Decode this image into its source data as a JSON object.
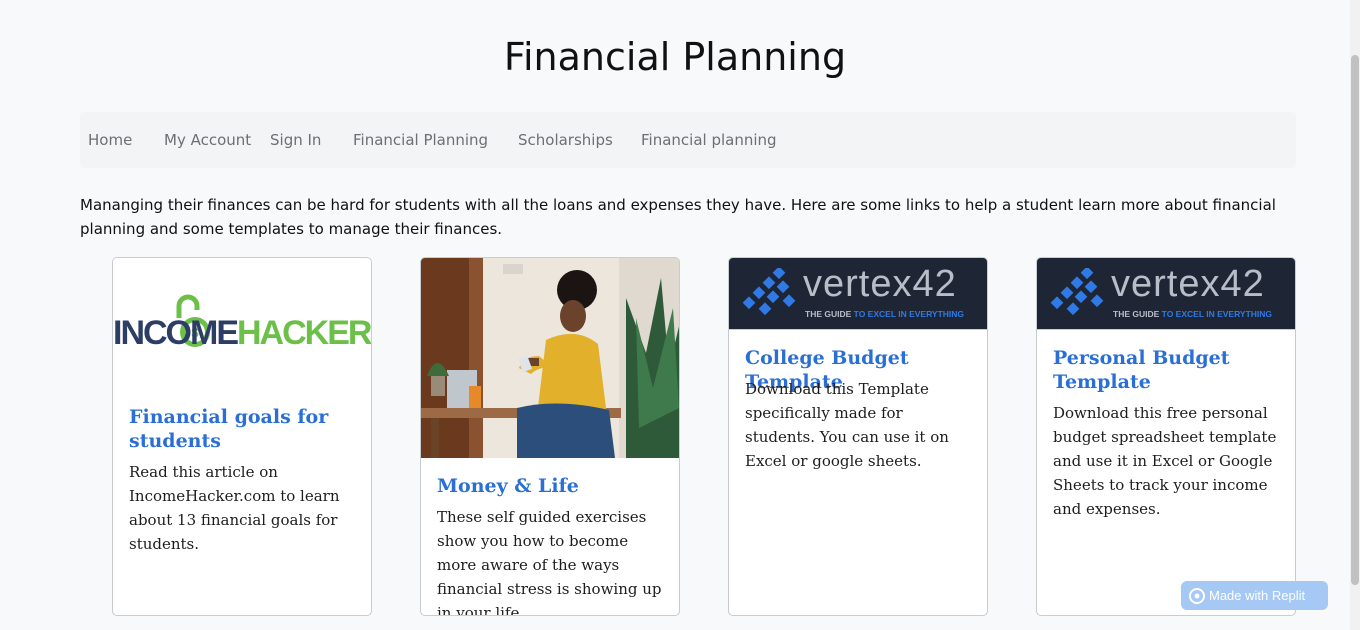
{
  "page": {
    "title": "Financial Planning"
  },
  "nav": {
    "items": [
      {
        "label": "Home"
      },
      {
        "label": "My Account"
      },
      {
        "label": "Sign In"
      },
      {
        "label": "Financial Planning"
      },
      {
        "label": "Scholarships"
      },
      {
        "label": "Financial planning"
      }
    ]
  },
  "intro": "Mananging their finances can be hard for students with all the loans and expenses they have. Here are some links to help a student learn more about financial planning and some templates to manage their finances.",
  "cards": [
    {
      "logo_text_dark": "INCOME",
      "logo_text_green": "HACKER",
      "title": "Financial goals for students",
      "text": "Read this article on IncomeHacker.com to learn about 13 financial goals for students."
    },
    {
      "title": "Money & Life",
      "text": "These self guided exercises show you how to become more aware of the ways financial stress is showing up in your life."
    },
    {
      "logo_main": "vertex42",
      "logo_tag_a": "THE GUIDE",
      "logo_tag_b": "TO EXCEL IN EVERYTHING",
      "title": "College Budget Template",
      "text": "Download this Template specifically made for students. You can use it on Excel or google sheets."
    },
    {
      "logo_main": "vertex42",
      "logo_tag_a": "THE GUIDE",
      "logo_tag_b": "TO EXCEL IN EVERYTHING",
      "title": "Personal Budget Template",
      "text": "Download this free personal budget spreadsheet template and use it in Excel or Google Sheets to track your income and expenses."
    }
  ],
  "badge": {
    "label": "Made with Replit"
  },
  "colors": {
    "link": "#2a6fd6",
    "income_dark": "#2c3e66",
    "income_green": "#6cc04a",
    "vertex_bg": "#1e2535",
    "vertex_blue": "#2f7ae5"
  }
}
